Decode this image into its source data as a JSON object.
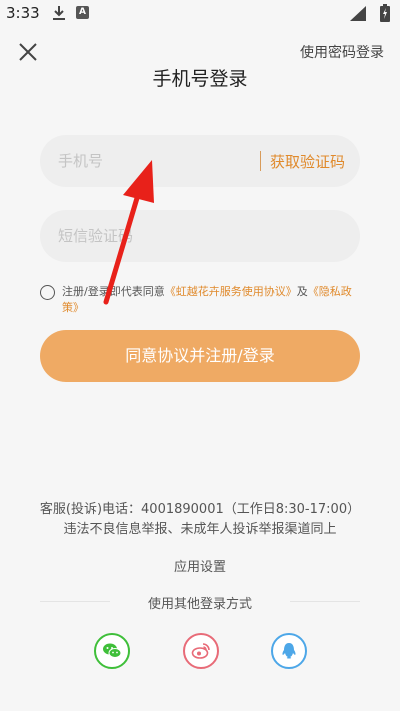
{
  "status_bar": {
    "time": "3:33",
    "icons": [
      "download-icon",
      "a-icon",
      "signal-icon",
      "battery-icon"
    ],
    "a_glyph": "A"
  },
  "header": {
    "close_icon": "close-icon",
    "password_login": "使用密码登录",
    "title": "手机号登录"
  },
  "form": {
    "phone_placeholder": "手机号",
    "phone_value": "",
    "get_code": "获取验证码",
    "code_placeholder": "短信验证码",
    "code_value": ""
  },
  "agreement": {
    "prefix": "注册/登录即代表同意",
    "link1": "《虹越花卉服务使用协议》",
    "and": "及",
    "link2": "《隐私政策》",
    "checked": false
  },
  "submit_label": "同意协议并注册/登录",
  "footer": {
    "service_line1": "客服(投诉)电话：4001890001（工作日8:30-17:00）",
    "service_line2": "违法不良信息举报、未成年人投诉举报渠道同上",
    "app_settings": "应用设置",
    "other_login": "使用其他登录方式",
    "social": [
      {
        "icon": "wechat-icon",
        "color": "#3fbf3a"
      },
      {
        "icon": "weibo-icon",
        "color": "#e86b78"
      },
      {
        "icon": "qq-icon",
        "color": "#4da7e8"
      }
    ]
  },
  "colors": {
    "accent": "#e08a2c",
    "button": "#efaa64",
    "annotation_arrow": "#e8211a"
  }
}
